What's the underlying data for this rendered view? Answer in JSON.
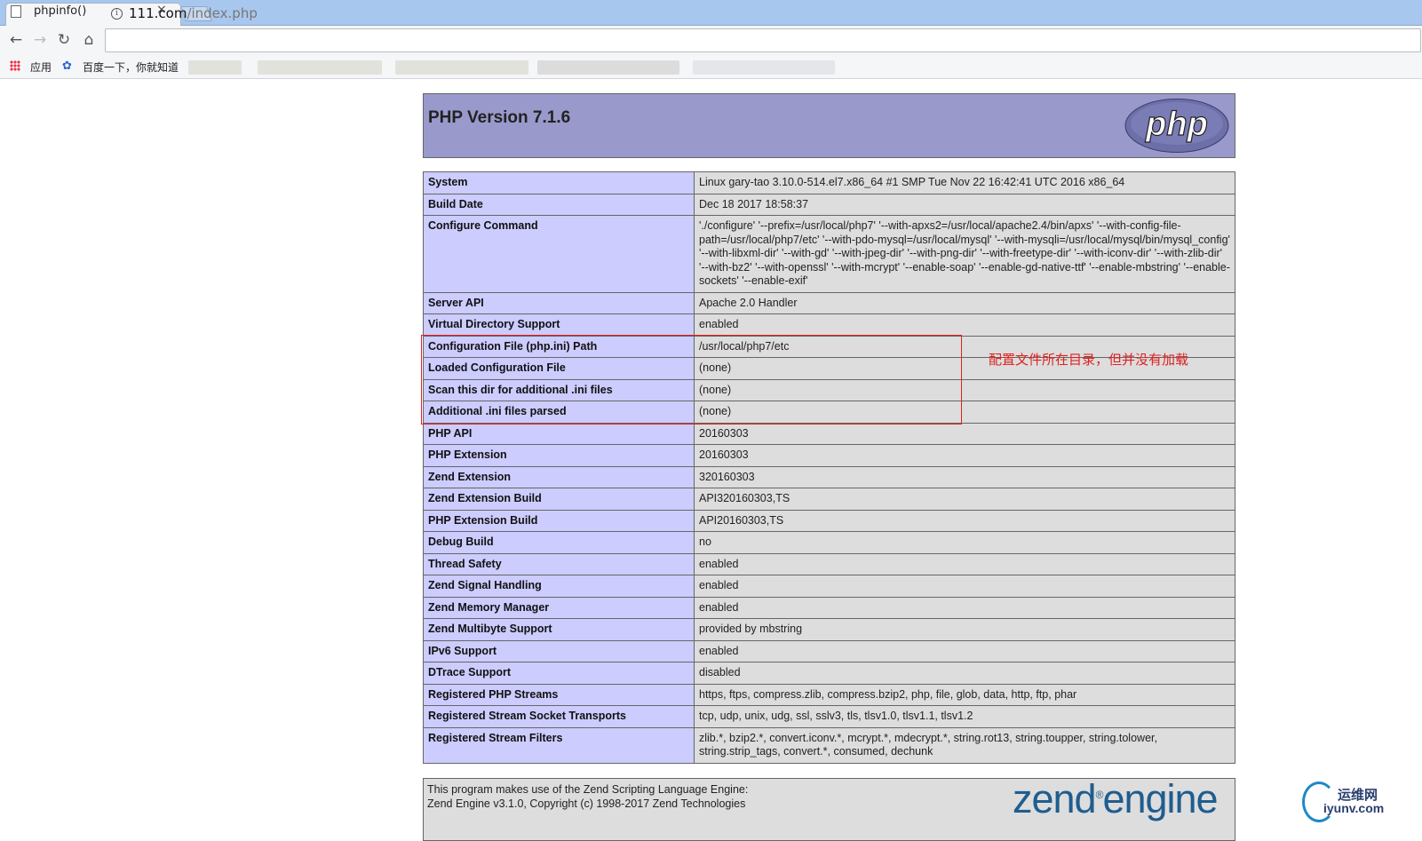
{
  "browser": {
    "tab_title": "phpinfo()",
    "tab_close": "×",
    "url_host": "111.com",
    "url_path": "/index.php",
    "nav": {
      "back": "←",
      "forward": "→",
      "reload": "↻",
      "home": "⌂"
    },
    "bookmarks": [
      {
        "label": "应用",
        "icon": "apps-grid-icon"
      },
      {
        "label": "百度一下，你就知道",
        "icon": "baidu-paw-icon"
      }
    ]
  },
  "header": {
    "title": "PHP Version 7.1.6",
    "logo_text": "php"
  },
  "rows": [
    {
      "k": "System",
      "v": "Linux gary-tao 3.10.0-514.el7.x86_64 #1 SMP Tue Nov 22 16:42:41 UTC 2016 x86_64"
    },
    {
      "k": "Build Date",
      "v": "Dec 18 2017 18:58:37"
    },
    {
      "k": "Configure Command",
      "v": "'./configure' '--prefix=/usr/local/php7' '--with-apxs2=/usr/local/apache2.4/bin/apxs' '--with-config-file-path=/usr/local/php7/etc' '--with-pdo-mysql=/usr/local/mysql' '--with-mysqli=/usr/local/mysql/bin/mysql_config' '--with-libxml-dir' '--with-gd' '--with-jpeg-dir' '--with-png-dir' '--with-freetype-dir' '--with-iconv-dir' '--with-zlib-dir' '--with-bz2' '--with-openssl' '--with-mcrypt' '--enable-soap' '--enable-gd-native-ttf' '--enable-mbstring' '--enable-sockets' '--enable-exif'"
    },
    {
      "k": "Server API",
      "v": "Apache 2.0 Handler"
    },
    {
      "k": "Virtual Directory Support",
      "v": "enabled"
    },
    {
      "k": "Configuration File (php.ini) Path",
      "v": "/usr/local/php7/etc"
    },
    {
      "k": "Loaded Configuration File",
      "v": "(none)"
    },
    {
      "k": "Scan this dir for additional .ini files",
      "v": "(none)"
    },
    {
      "k": "Additional .ini files parsed",
      "v": "(none)"
    },
    {
      "k": "PHP API",
      "v": "20160303"
    },
    {
      "k": "PHP Extension",
      "v": "20160303"
    },
    {
      "k": "Zend Extension",
      "v": "320160303"
    },
    {
      "k": "Zend Extension Build",
      "v": "API320160303,TS"
    },
    {
      "k": "PHP Extension Build",
      "v": "API20160303,TS"
    },
    {
      "k": "Debug Build",
      "v": "no"
    },
    {
      "k": "Thread Safety",
      "v": "enabled"
    },
    {
      "k": "Zend Signal Handling",
      "v": "enabled"
    },
    {
      "k": "Zend Memory Manager",
      "v": "enabled"
    },
    {
      "k": "Zend Multibyte Support",
      "v": "provided by mbstring"
    },
    {
      "k": "IPv6 Support",
      "v": "enabled"
    },
    {
      "k": "DTrace Support",
      "v": "disabled"
    },
    {
      "k": "Registered PHP Streams",
      "v": "https, ftps, compress.zlib, compress.bzip2, php, file, glob, data, http, ftp, phar"
    },
    {
      "k": "Registered Stream Socket Transports",
      "v": "tcp, udp, unix, udg, ssl, sslv3, tls, tlsv1.0, tlsv1.1, tlsv1.2"
    },
    {
      "k": "Registered Stream Filters",
      "v": "zlib.*, bzip2.*, convert.iconv.*, mcrypt.*, mdecrypt.*, string.rot13, string.toupper, string.tolower, string.strip_tags, convert.*, consumed, dechunk"
    }
  ],
  "annotation": "配置文件所在目录，但并没有加载",
  "footer": {
    "line1": "This program makes use of the Zend Scripting Language Engine:",
    "line2": "Zend Engine v3.1.0, Copyright (c) 1998-2017 Zend Technologies",
    "logo_word1": "zend",
    "logo_word2": "engine"
  },
  "watermark": {
    "line1": "运维网",
    "line2": "iyunv.com"
  },
  "colors": {
    "header_bg": "#9999cc",
    "key_bg": "#ccccff",
    "value_bg": "#dddddd",
    "annotation": "#e02020",
    "zend_blue": "#1f5d8f"
  }
}
